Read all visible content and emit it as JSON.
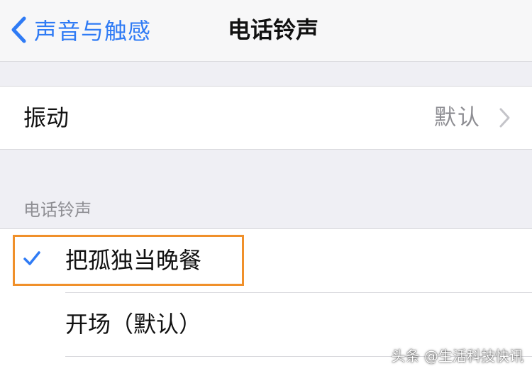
{
  "navbar": {
    "back_label": "声音与触感",
    "title": "电话铃声"
  },
  "vibration": {
    "label": "振动",
    "value": "默认"
  },
  "ringtones": {
    "section_header": "电话铃声",
    "items": [
      {
        "label": "把孤独当晚餐",
        "selected": true
      },
      {
        "label": "开场（默认）",
        "selected": false
      }
    ]
  },
  "watermark": "头条 @生活科技快讯",
  "colors": {
    "accent": "#2f7bf5",
    "highlight_border": "#f0902a",
    "secondary_text": "#8e8e93",
    "background": "#efeff4"
  },
  "icons": {
    "back": "chevron-left-icon",
    "disclosure": "chevron-right-icon",
    "selected": "checkmark-icon"
  }
}
